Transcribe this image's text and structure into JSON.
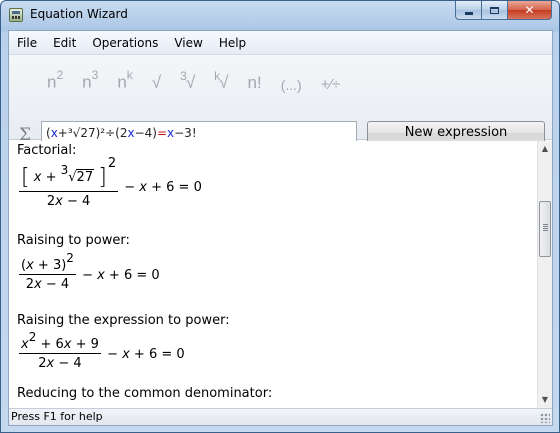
{
  "window": {
    "title": "Equation Wizard"
  },
  "menu": [
    "File",
    "Edit",
    "Operations",
    "View",
    "Help"
  ],
  "toolbar": {
    "ops": [
      {
        "name": "square-op",
        "base": "n",
        "sup": "2"
      },
      {
        "name": "cube-op",
        "base": "n",
        "sup": "3"
      },
      {
        "name": "power-k-op",
        "base": "n",
        "sup": "k"
      },
      {
        "name": "sqrt-op",
        "pre": "",
        "base": "√"
      },
      {
        "name": "cbrt-op",
        "pre": "3",
        "base": "√"
      },
      {
        "name": "root-k-op",
        "pre": "k",
        "base": "√"
      },
      {
        "name": "factorial-op",
        "base": "n!"
      },
      {
        "name": "parentheses-op",
        "base": "(...)"
      },
      {
        "name": "plus-minus-divide-op",
        "base": "+⁄÷"
      }
    ],
    "sigma": "Σ",
    "expression": {
      "t1": "(",
      "t2": "x",
      "t3": "+",
      "t4": "³√27)²÷(",
      "t5": "2",
      "t6": "x",
      "t7": "−4)",
      "t8": "=",
      "t9": "x",
      "t10": "−3!"
    },
    "new_button": "New expression"
  },
  "steps": {
    "s1": {
      "heading": "Factorial:",
      "open": "[",
      "x": "x",
      "plus": " + ",
      "root_index": "3",
      "radicand": "27",
      "close": "]",
      "power": "2",
      "den_a": "2",
      "den_x": "x",
      "den_b": " − 4",
      "tail_minus": " − ",
      "tail_x": "x",
      "tail_b": " + 6 = 0"
    },
    "s2": {
      "heading": "Raising to power:",
      "num": "(",
      "x": "x",
      "num_b": " + 3)",
      "power": "2",
      "den_a": "2",
      "den_x": "x",
      "den_b": " − 4",
      "tail_minus": " − ",
      "tail_x": "x",
      "tail_b": " + 6 = 0"
    },
    "s3": {
      "heading": "Raising the expression to power:",
      "x1": "x",
      "p": "2",
      "mid": " + 6",
      "x2": "x",
      "end": " + 9",
      "den_a": "2",
      "den_x": "x",
      "den_b": " − 4",
      "tail_minus": " − ",
      "tail_x": "x",
      "tail_b": " + 6 = 0"
    },
    "s4": {
      "heading": "Reducing to the common denominator:"
    }
  },
  "status": "Press F1 for help"
}
